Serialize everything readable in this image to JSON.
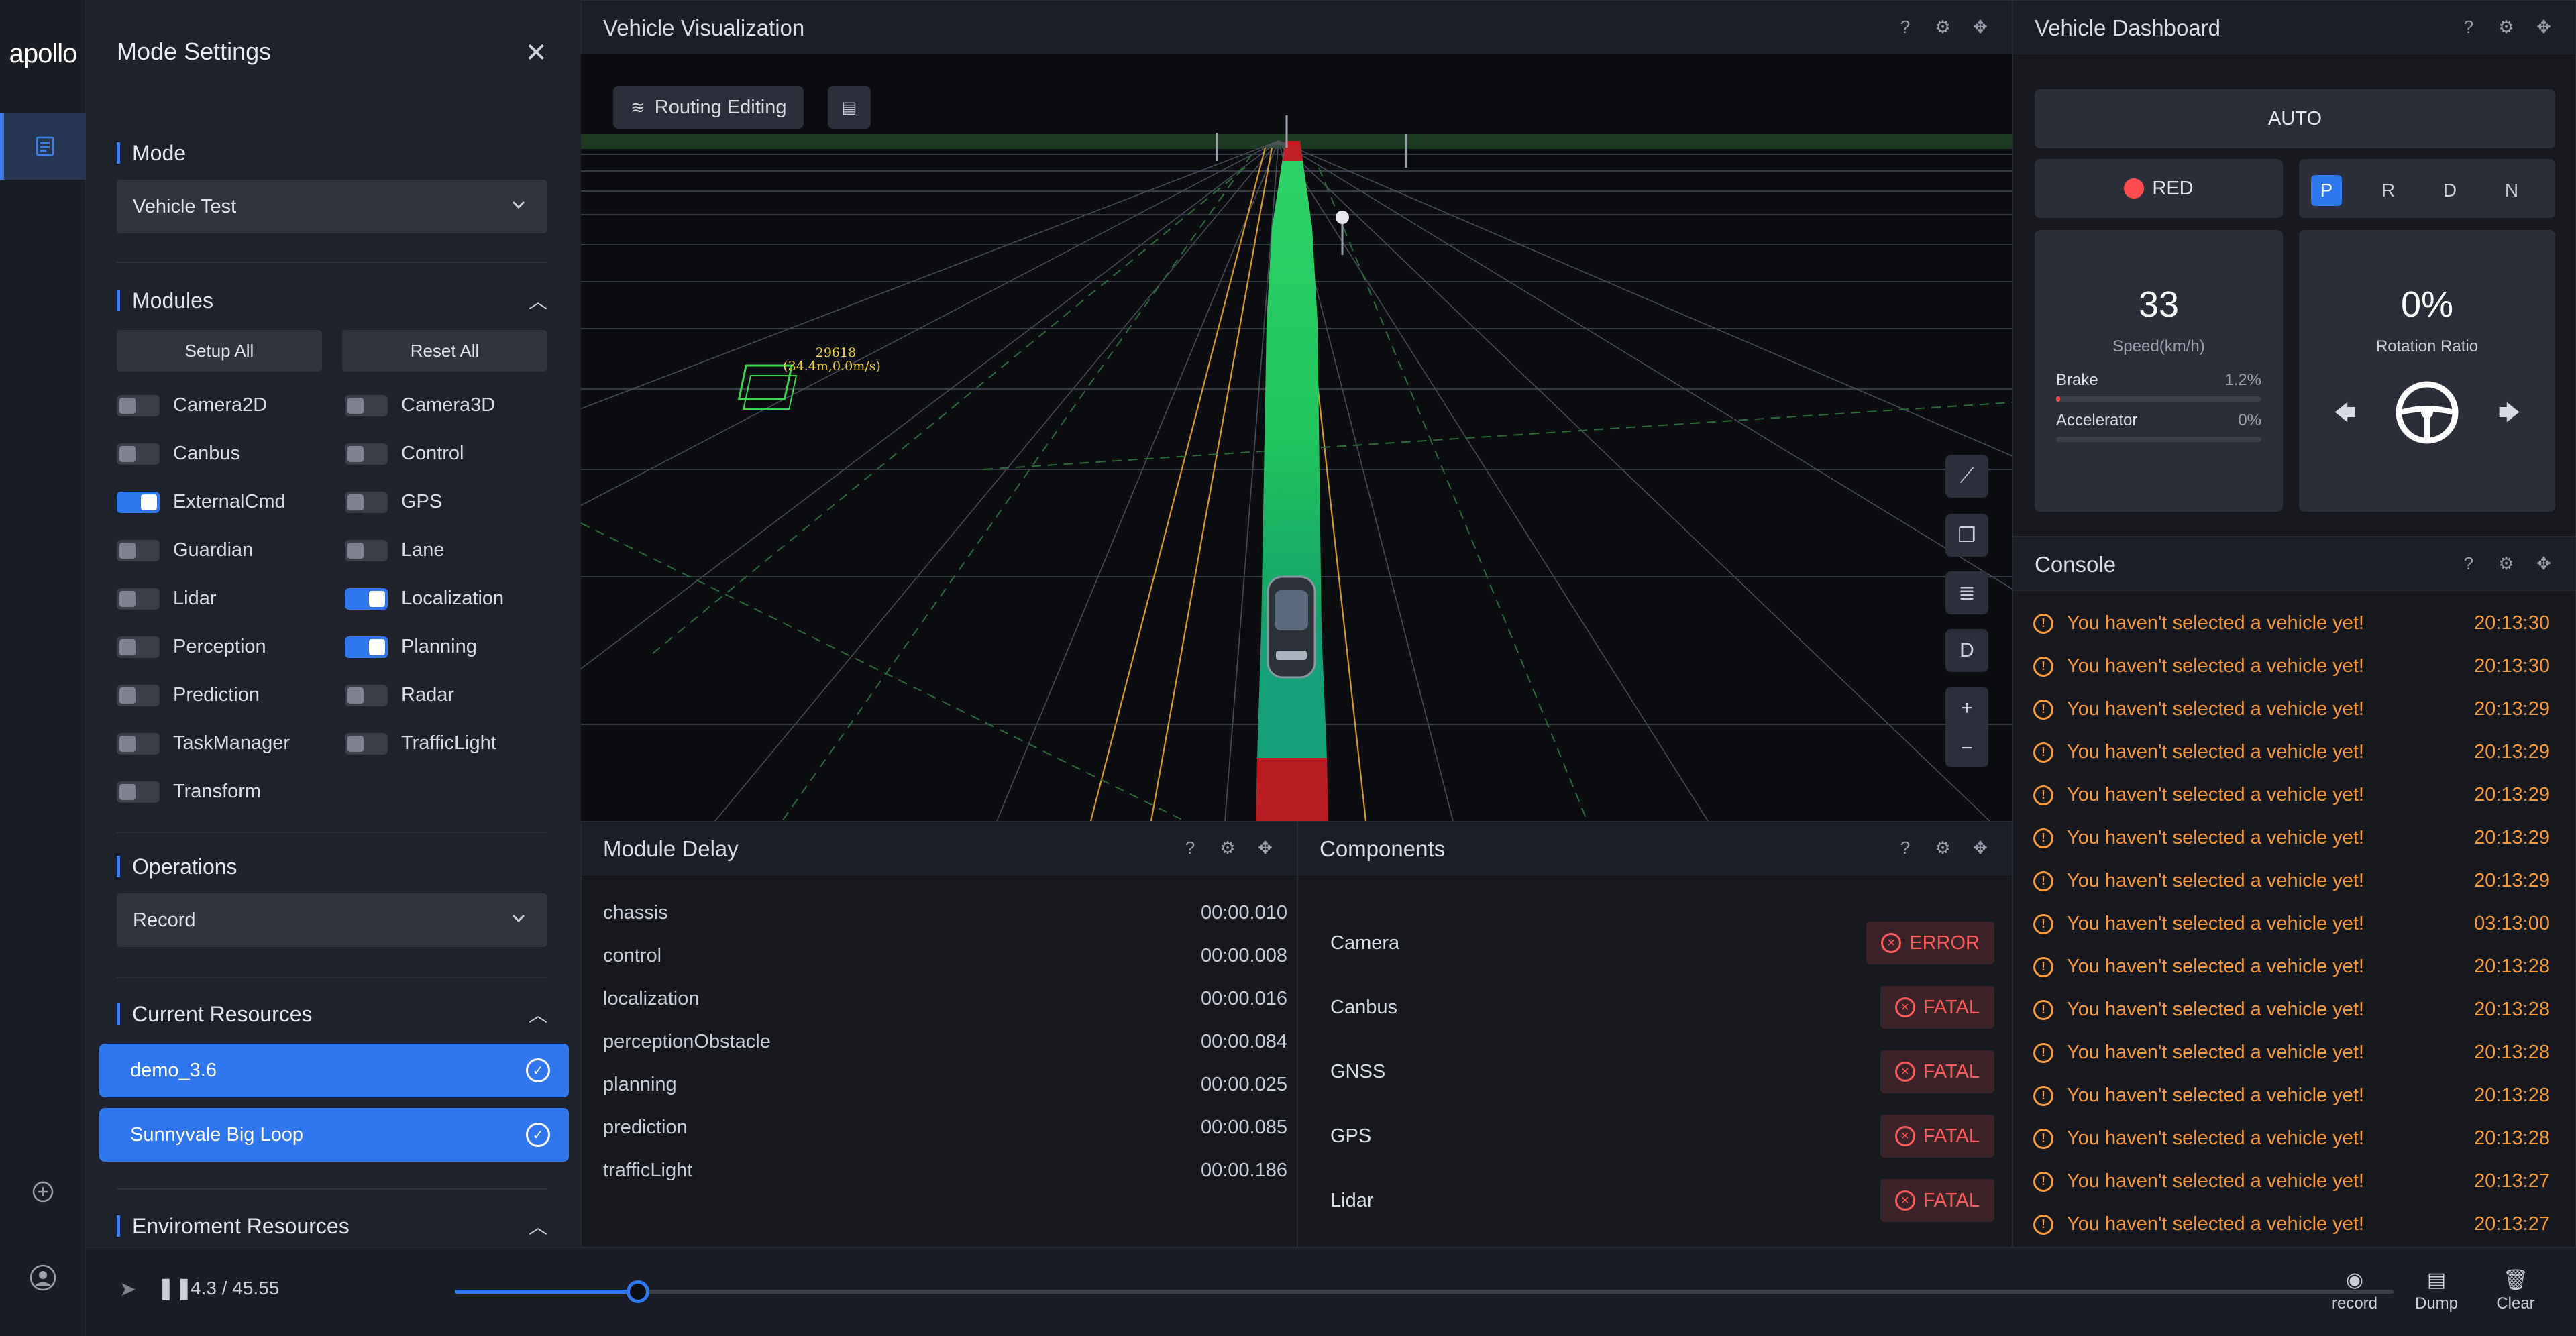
{
  "app": {
    "logo": "apollo"
  },
  "settings": {
    "title": "Mode Settings",
    "mode_section": "Mode",
    "mode_value": "Vehicle Test",
    "modules_section": "Modules",
    "setup_all": "Setup All",
    "reset_all": "Reset All",
    "modules": [
      {
        "label": "Camera2D",
        "on": false
      },
      {
        "label": "Camera3D",
        "on": false
      },
      {
        "label": "Canbus",
        "on": false
      },
      {
        "label": "Control",
        "on": false
      },
      {
        "label": "ExternalCmd",
        "on": true
      },
      {
        "label": "GPS",
        "on": false
      },
      {
        "label": "Guardian",
        "on": false
      },
      {
        "label": "Lane",
        "on": false
      },
      {
        "label": "Lidar",
        "on": false
      },
      {
        "label": "Localization",
        "on": true
      },
      {
        "label": "Perception",
        "on": false
      },
      {
        "label": "Planning",
        "on": true
      },
      {
        "label": "Prediction",
        "on": false
      },
      {
        "label": "Radar",
        "on": false
      },
      {
        "label": "TaskManager",
        "on": false
      },
      {
        "label": "TrafficLight",
        "on": false
      },
      {
        "label": "Transform",
        "on": false
      }
    ],
    "operations_section": "Operations",
    "operations_value": "Record",
    "current_resources_section": "Current Resources",
    "resources": [
      "demo_3.6",
      "Sunnyvale Big Loop"
    ],
    "env_resources_section": "Enviroment Resources"
  },
  "viz": {
    "title": "Vehicle Visualization",
    "routing_editing": "Routing Editing",
    "obstacle_id": "29618",
    "obstacle_info": "(34.4m,0.0m/s)",
    "view_mode": "D"
  },
  "delay": {
    "title": "Module Delay",
    "rows": [
      {
        "name": "chassis",
        "value": "00:00.010"
      },
      {
        "name": "control",
        "value": "00:00.008"
      },
      {
        "name": "localization",
        "value": "00:00.016"
      },
      {
        "name": "perceptionObstacle",
        "value": "00:00.084"
      },
      {
        "name": "planning",
        "value": "00:00.025"
      },
      {
        "name": "prediction",
        "value": "00:00.085"
      },
      {
        "name": "trafficLight",
        "value": "00:00.186"
      }
    ]
  },
  "components": {
    "title": "Components",
    "rows": [
      {
        "name": "Camera",
        "status": "ERROR"
      },
      {
        "name": "Canbus",
        "status": "FATAL"
      },
      {
        "name": "GNSS",
        "status": "FATAL"
      },
      {
        "name": "GPS",
        "status": "FATAL"
      },
      {
        "name": "Lidar",
        "status": "FATAL"
      }
    ]
  },
  "dashboard": {
    "title": "Vehicle Dashboard",
    "drive_mode": "AUTO",
    "signal": "RED",
    "gears": [
      "P",
      "R",
      "D",
      "N"
    ],
    "active_gear": "P",
    "speed": "33",
    "speed_label": "Speed(km/h)",
    "brake_label": "Brake",
    "brake_value": "1.2%",
    "brake_fraction": 0.012,
    "accel_label": "Accelerator",
    "accel_value": "0%",
    "accel_fraction": 0,
    "rotation": "0%",
    "rotation_label": "Rotation Ratio"
  },
  "console": {
    "title": "Console",
    "rows": [
      {
        "msg": "You haven't selected a vehicle yet!",
        "time": "20:13:30"
      },
      {
        "msg": "You haven't selected a vehicle yet!",
        "time": "20:13:30"
      },
      {
        "msg": "You haven't selected a vehicle yet!",
        "time": "20:13:29"
      },
      {
        "msg": "You haven't selected a vehicle yet!",
        "time": "20:13:29"
      },
      {
        "msg": "You haven't selected a vehicle yet!",
        "time": "20:13:29"
      },
      {
        "msg": "You haven't selected a vehicle yet!",
        "time": "20:13:29"
      },
      {
        "msg": "You haven't selected a vehicle yet!",
        "time": "20:13:29"
      },
      {
        "msg": "You haven't selected a vehicle yet!",
        "time": "03:13:00"
      },
      {
        "msg": "You haven't selected a vehicle yet!",
        "time": "20:13:28"
      },
      {
        "msg": "You haven't selected a vehicle yet!",
        "time": "20:13:28"
      },
      {
        "msg": "You haven't selected a vehicle yet!",
        "time": "20:13:28"
      },
      {
        "msg": "You haven't selected a vehicle yet!",
        "time": "20:13:28"
      },
      {
        "msg": "You haven't selected a vehicle yet!",
        "time": "20:13:28"
      },
      {
        "msg": "You haven't selected a vehicle yet!",
        "time": "20:13:27"
      },
      {
        "msg": "You haven't selected a vehicle yet!",
        "time": "20:13:27"
      }
    ]
  },
  "player": {
    "position": "4.3",
    "duration": "45.55",
    "progress": 0.0944,
    "record_label": "record",
    "dump_label": "Dump",
    "clear_label": "Clear"
  },
  "colors": {
    "accent": "#2f78f0",
    "error": "#ff5a5a",
    "warning": "#f79a3a"
  }
}
